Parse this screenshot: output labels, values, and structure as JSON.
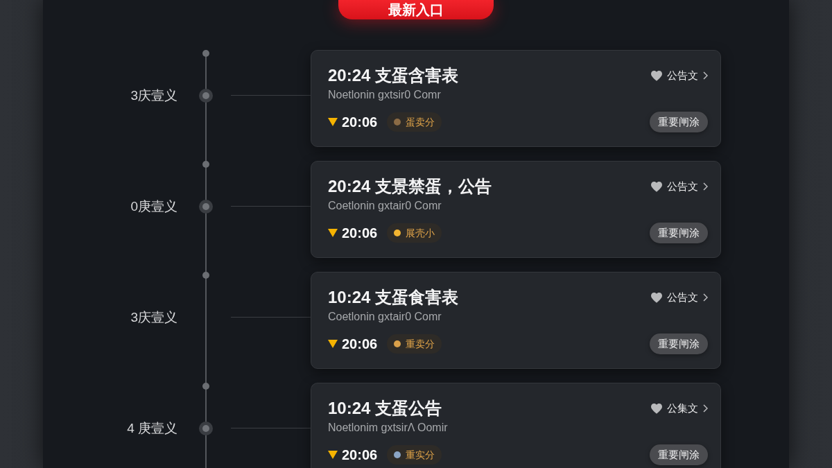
{
  "header_button": {
    "label": "最新入口"
  },
  "timeline": [
    {
      "label": "3庆壹义",
      "marker": true,
      "card": {
        "title": "20:24 支蛋含害表",
        "subtitle": "Noetlonin gxtsir0 Comr",
        "time": "20:06",
        "tag": {
          "label": "蛋卖分",
          "color": "#8b6b45"
        },
        "link": "公告文",
        "button": "重要闸涂"
      }
    },
    {
      "label": "0庚壹义",
      "marker": true,
      "card": {
        "title": "20:24 支景禁蛋，公告",
        "subtitle": "Coetlonin gxtair0 Comr",
        "time": "20:06",
        "tag": {
          "label": "展壳小",
          "color": "#f2b431"
        },
        "link": "公告文",
        "button": "重要闸涂"
      }
    },
    {
      "label": "3庆壹义",
      "marker": false,
      "card": {
        "title": "10:24 支蛋食害表",
        "subtitle": "Coetlonin gxtair0 Comr",
        "time": "20:06",
        "tag": {
          "label": "重卖分",
          "color": "#d9a04a"
        },
        "link": "公告文",
        "button": "重要闸涂"
      }
    },
    {
      "label": "4 庚壹义",
      "marker": true,
      "card": {
        "title": "10:24 支蛋公告",
        "subtitle": "Noetlonim gxtsirΛ Oomir",
        "time": "20:06",
        "tag": {
          "label": "重实分",
          "color": "#8aa4c4"
        },
        "link": "公集文",
        "button": "重要闸涂"
      }
    }
  ]
}
